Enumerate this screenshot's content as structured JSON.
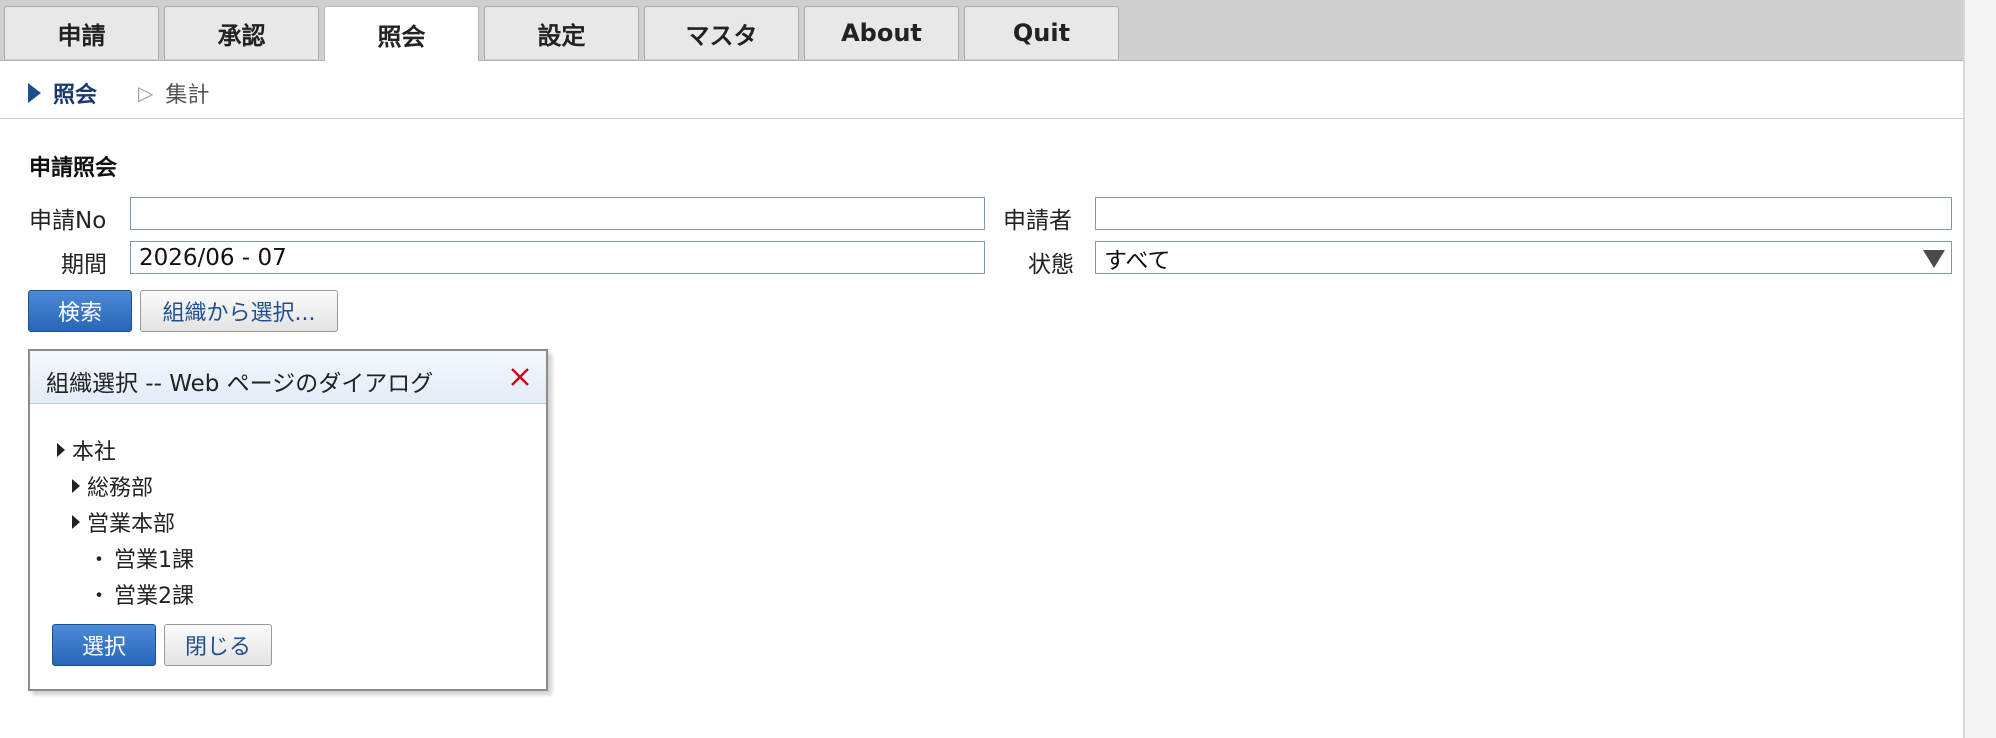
{
  "tabs": [
    {
      "label": "申請",
      "active": false
    },
    {
      "label": "承認",
      "active": false
    },
    {
      "label": "照会",
      "active": true
    },
    {
      "label": "設定",
      "active": false
    },
    {
      "label": "マスタ",
      "active": false
    },
    {
      "label": "About",
      "active": false
    },
    {
      "label": "Quit",
      "active": false
    }
  ],
  "subnav": {
    "current": "照会",
    "other": "集計"
  },
  "form": {
    "section_title": "申請照会",
    "app_no_label": "申請No",
    "app_no_value": "",
    "applicant_label": "申請者",
    "applicant_value": "",
    "period_label": "期間",
    "period_value": "2026/06 - 07",
    "status_label": "状態",
    "status_value": "すべて",
    "search_button": "検索",
    "org_select_button": "組織から選択..."
  },
  "dialog": {
    "title": "組織選択 -- Web ページのダイアログ",
    "tree": [
      {
        "label": "本社",
        "type": "branch"
      },
      {
        "label": "総務部",
        "type": "branch"
      },
      {
        "label": "営業本部",
        "type": "branch"
      },
      {
        "label": "営業1課",
        "type": "leaf"
      },
      {
        "label": "営業2課",
        "type": "leaf"
      }
    ],
    "select_button": "選択",
    "close_button": "閉じる"
  },
  "colors": {
    "primary": "#2866b8",
    "close_icon": "#d0021b",
    "nav_active": "#1e4d8c"
  }
}
